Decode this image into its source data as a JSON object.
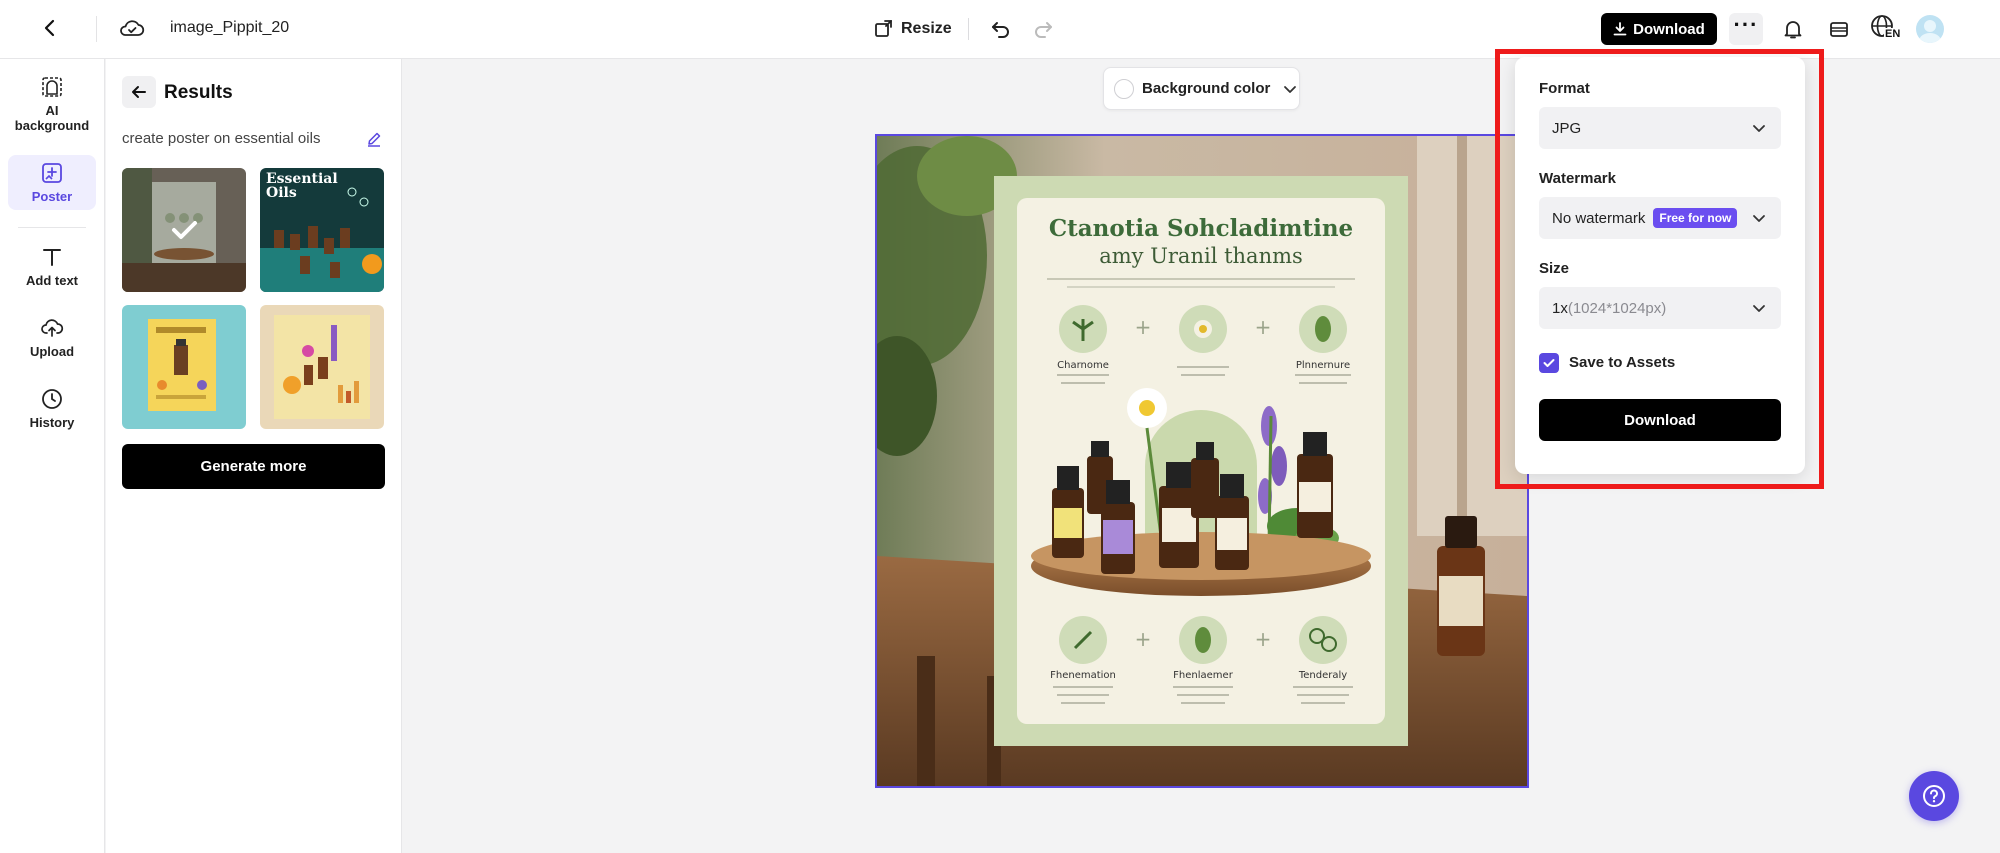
{
  "topbar": {
    "file_name": "image_Pippit_20",
    "resize_label": "Resize",
    "download_label": "Download",
    "lang_code": "EN"
  },
  "leftnav": {
    "items": [
      {
        "label": "AI background",
        "icon": "ai-background-icon"
      },
      {
        "label": "Poster",
        "icon": "poster-icon",
        "active": true
      },
      {
        "label": "Add text",
        "icon": "text-icon"
      },
      {
        "label": "Upload",
        "icon": "upload-icon"
      },
      {
        "label": "History",
        "icon": "history-icon"
      }
    ]
  },
  "results": {
    "title": "Results",
    "prompt": "create poster on essential oils",
    "thumbnails": [
      {
        "name": "thumbnail-1",
        "selected": true
      },
      {
        "name": "thumbnail-2",
        "selected": false,
        "caption": "Essential Oils"
      },
      {
        "name": "thumbnail-3",
        "selected": false
      },
      {
        "name": "thumbnail-4",
        "selected": false
      }
    ],
    "generate_label": "Generate more"
  },
  "canvas": {
    "bg_color_label": "Background color",
    "poster_title": "Ctanotia Sohcladimtine",
    "poster_subtitle": "amy Uranil thanms",
    "top_labels": [
      "Charnome",
      "",
      "Plnnernure"
    ],
    "bottom_labels": [
      "Fhenemation",
      "Fhenlaemer",
      "Tenderaly"
    ]
  },
  "download_menu": {
    "format_label": "Format",
    "format_value": "JPG",
    "watermark_label": "Watermark",
    "watermark_value": "No watermark",
    "watermark_badge": "Free for now",
    "size_label": "Size",
    "size_value": "1x",
    "size_detail": "(1024*1024px)",
    "save_label": "Save to Assets",
    "save_checked": true,
    "download_label": "Download"
  },
  "colors": {
    "accent": "#5a48e0",
    "highlight": "#ee1b1b",
    "button": "#000000"
  }
}
